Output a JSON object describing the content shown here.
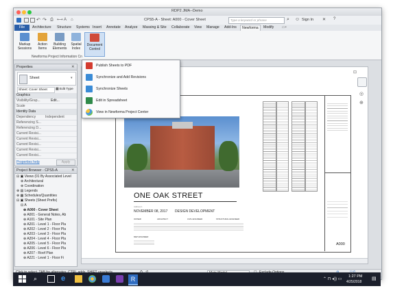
{
  "window": {
    "title": "RDP2 JMA--Demo"
  },
  "qat": {
    "doc_title": "CPS5-A - Sheet: A000 - Cover Sheet",
    "search_placeholder": "Type a keyword or phrase",
    "sign_in": "Sign In"
  },
  "tabs": [
    "File",
    "Architecture",
    "Structure",
    "Systems",
    "Insert",
    "Annotate",
    "Analyze",
    "Massing & Site",
    "Collaborate",
    "View",
    "Manage",
    "Add-Ins",
    "Newforma",
    "Modify"
  ],
  "ribbon": {
    "buttons": [
      {
        "label": "Markup\nSessions",
        "icon": "markup-icon"
      },
      {
        "label": "Action\nItems",
        "icon": "action-items-icon"
      },
      {
        "label": "Building\nElements",
        "icon": "building-elements-icon"
      },
      {
        "label": "Spatial\nIndex",
        "icon": "spatial-index-icon"
      },
      {
        "label": "Document\nControl",
        "icon": "document-control-icon"
      }
    ],
    "group_label": "Newforma Project Information Cn"
  },
  "dropdown": {
    "items": [
      {
        "label": "Publish Sheets to PDF",
        "icon": "pdf-icon"
      },
      {
        "label": "Synchronize and Add Revisions",
        "icon": "sync-revisions-icon"
      },
      {
        "label": "Synchronize Sheets",
        "icon": "sync-sheets-icon"
      },
      {
        "label": "Edit in Spreadsheet",
        "icon": "spreadsheet-icon"
      },
      {
        "label": "View in Newforma Project Center",
        "icon": "project-center-icon"
      }
    ]
  },
  "properties": {
    "title": "Properties",
    "type": "Sheet",
    "selector": "Sheet: Cover Sheet",
    "edit_type": "Edit Type",
    "sections": [
      "Graphics",
      "Identity Data"
    ],
    "rows": [
      {
        "k": "Visibility/Grap...",
        "v": "Edit..."
      },
      {
        "k": "Scale",
        "v": ""
      },
      {
        "k": "Dependency",
        "v": "Independent"
      },
      {
        "k": "Referencing S...",
        "v": ""
      },
      {
        "k": "Referencing D...",
        "v": ""
      },
      {
        "k": "Current Revisi...",
        "v": ""
      },
      {
        "k": "Current Revisi...",
        "v": ""
      },
      {
        "k": "Current Revisi...",
        "v": ""
      },
      {
        "k": "Current Revisi...",
        "v": ""
      },
      {
        "k": "Current Revisi...",
        "v": ""
      }
    ],
    "help": "Properties help",
    "apply": "Apply"
  },
  "browser": {
    "title": "Project Browser - CPS5-A",
    "items": [
      "Views (01 By Associated Level",
      "Architectural",
      "Coordination",
      "Legends",
      "Schedules/Quantities",
      "Sheets (Sheet Prefix)",
      "A",
      "A000 - Cover Sheet",
      "A001 - General Notes, Ab",
      "A101 - Site Plan",
      "A201 - Level 1 - Floor Pla",
      "A202 - Level 2 - Floor Pla",
      "A203 - Level 3 - Floor Pla",
      "A204 - Level 4 - Floor Pla",
      "A205 - Level 5 - Floor Pla",
      "A206 - Level 6 - Floor Pla",
      "A207 - Roof Plan",
      "A221 - Level 1 - Floor Fi"
    ]
  },
  "sheet": {
    "title": "ONE OAK STREET",
    "date": "NOVEMBER 08, 2017",
    "phase": "DESIGN DEVELOPMENT",
    "sheet_number": "A000",
    "label_row": [
      "OWNER",
      "ARCHITECT",
      "CIVIL ENGINEER",
      "STRUCTURAL ENGINEER"
    ],
    "mep": "MEP ENGINEER"
  },
  "status": {
    "hint": "Click to select, TAB for alternates, CTRL adds, SHIFT unselects.",
    "model": "Main Model",
    "exclude": "Exclude Options",
    "zoom": ":0"
  },
  "taskbar": {
    "time": "1:27 PM",
    "date": "4/25/2018"
  },
  "colors": {
    "accent": "#2d6fc0",
    "file_tab": "#2a5ea8",
    "taskbar": "#1b1f2b"
  }
}
